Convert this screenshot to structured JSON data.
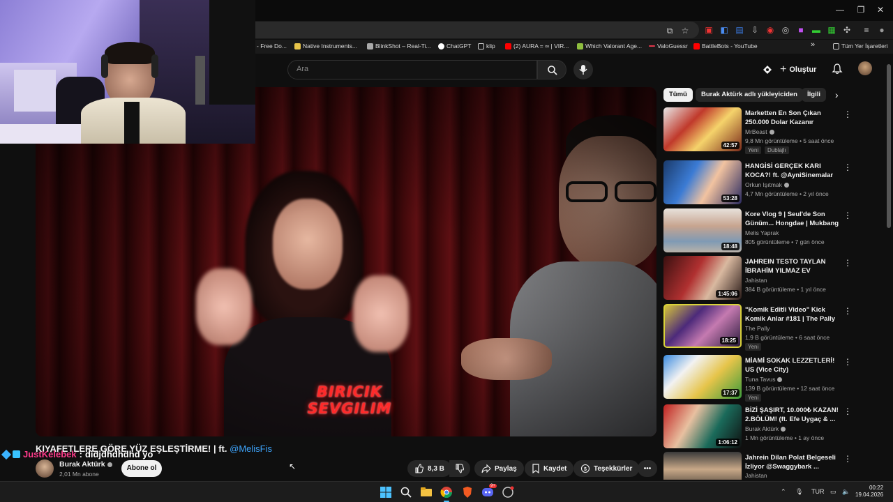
{
  "browser": {
    "bookmarks": [
      "- Free Do...",
      "Native Instruments...",
      "BlinkShot – Real-Ti...",
      "ChatGPT",
      "klip",
      "(2) AURA = ∞ | VIR...",
      "Which Valorant Age...",
      "ValoGuessr",
      "BattleBots - YouTube"
    ],
    "all_bookmarks": "Tüm Yer İşaretleri",
    "more_bookmarks": "»"
  },
  "header": {
    "search_placeholder": "Ara",
    "create_label": "Oluştur"
  },
  "player": {
    "caption": "BIRICIK SEVGILIM"
  },
  "video": {
    "title_main": "KIYAFETLERE GÖRE YÜZ EŞLEŞTİRME! | ft. ",
    "title_mention": "@MelisFis",
    "channel": "Burak Aktürk",
    "subscribers": "2,01 Mn abone",
    "subscribe_label": "Abone ol",
    "likes": "8,3 B",
    "share_label": "Paylaş",
    "save_label": "Kaydet",
    "thanks_label": "Teşekkürler",
    "more_label": "•••"
  },
  "chat_overlay": {
    "user": "JustKelebek",
    "separator": ":",
    "message": "didjdhdhdhd yo"
  },
  "sidebar": {
    "chips": [
      "Tümü",
      "Burak Aktürk adlı yükleyiciden",
      "İlgili"
    ],
    "recommendations": [
      {
        "title": "Marketten En Son Çıkan 250.000 Dolar Kazanır",
        "channel": "MrBeast",
        "verified": true,
        "meta": "9,8 Mn görüntüleme • 5 saat önce",
        "duration": "42:57",
        "badge": "Yeni",
        "badge2": "Dublajlı"
      },
      {
        "title": "HANGİSİ GERÇEK KARI KOCA?! ft. @AyniSinemalar",
        "channel": "Orkun Işıtmak",
        "verified": true,
        "meta": "4,7 Mn görüntüleme • 2 yıl önce",
        "duration": "53:28"
      },
      {
        "title": "Kore Vlog 9 | Seul'de Son Günüm... Hongdae | Mukbang |...",
        "channel": "Melis Yaprak",
        "verified": false,
        "meta": "805 görüntüleme • 7 gün önce",
        "duration": "18:48"
      },
      {
        "title": "JAHREIN TESTO TAYLAN İBRAHİM YILMAZ EV ZİYARET...",
        "channel": "Jahistan",
        "verified": false,
        "meta": "384 B görüntüleme • 1 yıl önce",
        "duration": "1:45:06"
      },
      {
        "title": "\"Komik Editli Video\" Kick Komik Anlar #181 | The Pally",
        "channel": "The Pally",
        "verified": false,
        "meta": "1,9 B görüntüleme • 6 saat önce",
        "duration": "18:25",
        "badge": "Yeni"
      },
      {
        "title": "MİAMİ SOKAK LEZZETLERİ! US (Vice City)",
        "channel": "Tuna Tavus",
        "verified": true,
        "meta": "139 B görüntüleme • 12 saat önce",
        "duration": "17:37",
        "badge": "Yeni"
      },
      {
        "title": "BİZİ ŞAŞIRT, 10.000₺ KAZAN! 2.BÖLÜM! (ft. Efe Uygaç & ...",
        "channel": "Burak Aktürk",
        "verified": true,
        "meta": "1 Mn görüntüleme • 1 ay önce",
        "duration": "1:06:12"
      },
      {
        "title": "Jahrein Dilan Polat Belgeseli İzliyor @Swaggybark ...",
        "channel": "Jahistan",
        "verified": false,
        "meta": "",
        "duration": ""
      }
    ]
  },
  "taskbar": {
    "lang": "TUR",
    "time": "00:22",
    "date": "19.04.2026",
    "discord_badge": "9+"
  },
  "colors": {
    "accent_link": "#3ea6ff",
    "chat_user": "#ff3b8b",
    "caption_red": "#ff2a2a",
    "background": "#0f0f0f"
  }
}
